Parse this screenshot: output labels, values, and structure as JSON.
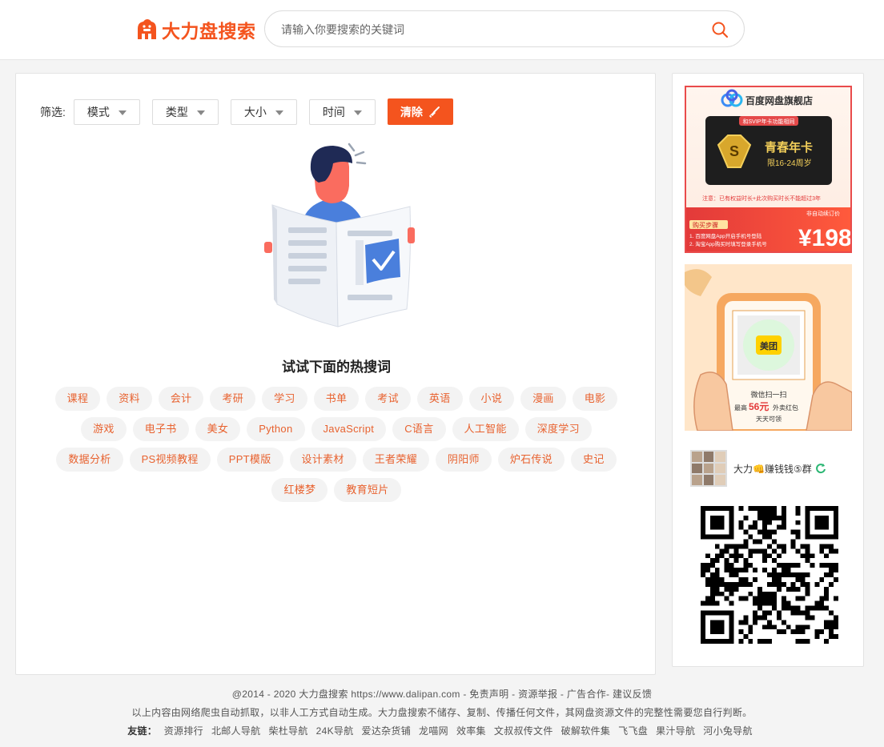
{
  "header": {
    "logo_text": "大力盘搜索",
    "search_placeholder": "请输入你要搜索的关键词"
  },
  "filters": {
    "label": "筛选:",
    "dropdowns": [
      "模式",
      "类型",
      "大小",
      "时间"
    ],
    "clear_label": "清除"
  },
  "hot": {
    "title": "试试下面的热搜词",
    "tags": [
      "课程",
      "资料",
      "会计",
      "考研",
      "学习",
      "书单",
      "考试",
      "英语",
      "小说",
      "漫画",
      "电影",
      "游戏",
      "电子书",
      "美女",
      "Python",
      "JavaScript",
      "C语言",
      "人工智能",
      "深度学习",
      "数据分析",
      "PS视频教程",
      "PPT模版",
      "设计素材",
      "王者荣耀",
      "阴阳师",
      "炉石传说",
      "史记",
      "红楼梦",
      "教育短片"
    ]
  },
  "sidebar": {
    "ad1": {
      "brand": "百度网盘旗舰店",
      "card_note": "和SVIP年卡功能相同",
      "card_title": "青春年卡",
      "card_sub": "限16-24周岁",
      "notice": "注意：已有权益时长+此次购买时长不能超过3年",
      "steps_title": "购买步骤",
      "step1": "1. 百度网盘App开启手机号登陆",
      "step2": "2. 淘宝App购买时填写登录手机号",
      "price_note": "非自动续订价",
      "price": "¥198"
    },
    "ad2": {
      "logo_text": "美团",
      "line1": "微信扫一扫",
      "line2_prefix": "最高",
      "line2_amount": "56元",
      "line2_suffix": "外卖红包",
      "line3": "天天可领"
    },
    "group_name": "大力👊赚钱钱⑤群"
  },
  "footer": {
    "line1": [
      "@2014 - 2020 大力盘搜索 https://www.dalipan.com",
      "免责声明",
      "资源举报",
      "广告合作",
      "建议反馈"
    ],
    "line2": "以上内容由网络爬虫自动抓取，以非人工方式自动生成。大力盘搜索不储存、复制、传播任何文件，其网盘资源文件的完整性需要您自行判断。",
    "friend_label": "友链：",
    "friend_links": [
      "资源排行",
      "北邮人导航",
      "柴杜导航",
      "24K导航",
      "爱达杂货铺",
      "龙喵网",
      "效率集",
      "文叔叔传文件",
      "破解软件集",
      "飞飞盘",
      "果汁导航",
      "河小兔导航"
    ]
  },
  "colors": {
    "accent": "#f4541e",
    "tag_text": "#e8622f",
    "tag_bg": "#f3f3f3"
  }
}
